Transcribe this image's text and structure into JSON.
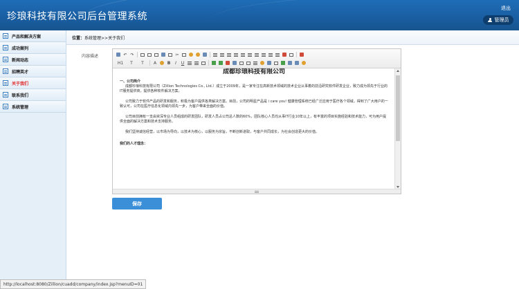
{
  "header": {
    "title": "珍琅科技有限公司后台管理系统",
    "logout": "退出",
    "admin_label": "管理员"
  },
  "sidebar": {
    "items": [
      {
        "label": "产品和解决方案",
        "active": false
      },
      {
        "label": "成功案列",
        "active": false
      },
      {
        "label": "新闻动态",
        "active": false
      },
      {
        "label": "招聘英才",
        "active": false
      },
      {
        "label": "关于我们",
        "active": true
      },
      {
        "label": "联系我们",
        "active": false
      },
      {
        "label": "系统管理",
        "active": false
      }
    ]
  },
  "breadcrumb": {
    "prefix": "位置：",
    "path": "系统管理>>关于我们"
  },
  "form": {
    "label": "内容描述",
    "save_label": "保存"
  },
  "editor": {
    "toolbar_row2_labels": [
      "H1",
      "T",
      "A",
      "B",
      "I",
      "U"
    ],
    "doc_title": "成都珍琅科技有限公司",
    "section1": "一、公司简介",
    "para1": "成都珍琅科技有限公司（Zillion Technologies Co., Ltd.）成立于2009年，是一家专注在高新技术领域的技术企业从事着的前沿研究软件研发企业，致力成为领先于行业的IT服务提供商，提供各种软件解决方案。",
    "para2": "公司致力于软件产品的研发和服务，积极为客户提供各类解决方案。目前，公司的明星产品是 i care you! 健康管理系统已经广泛应用于医疗各个领域，得到了广大用户的一致认可，公司在医疗信息化领域内领先一步，为客户带来全面的价值。",
    "para3": "公司目前拥有一支由资深专业人员组成的研发团队，研发人员占公司总人数的60%，团队核心人员均从事IT行业10年以上，有丰富的项目实施经验和技术能力，可为用户提供全面的解决方案和技术支持服务。",
    "para4": "我们坚持诚信经营，以市场为导向，以技术为核心，以服务为宗旨，不断创新进取，与客户共同成长，为社会创造更大的价值。",
    "section2": "我们的人才理念："
  },
  "statusbar": {
    "url": "http://localhost:8080/Zillion/cuadd/company/index.jsp?menuID=01"
  }
}
